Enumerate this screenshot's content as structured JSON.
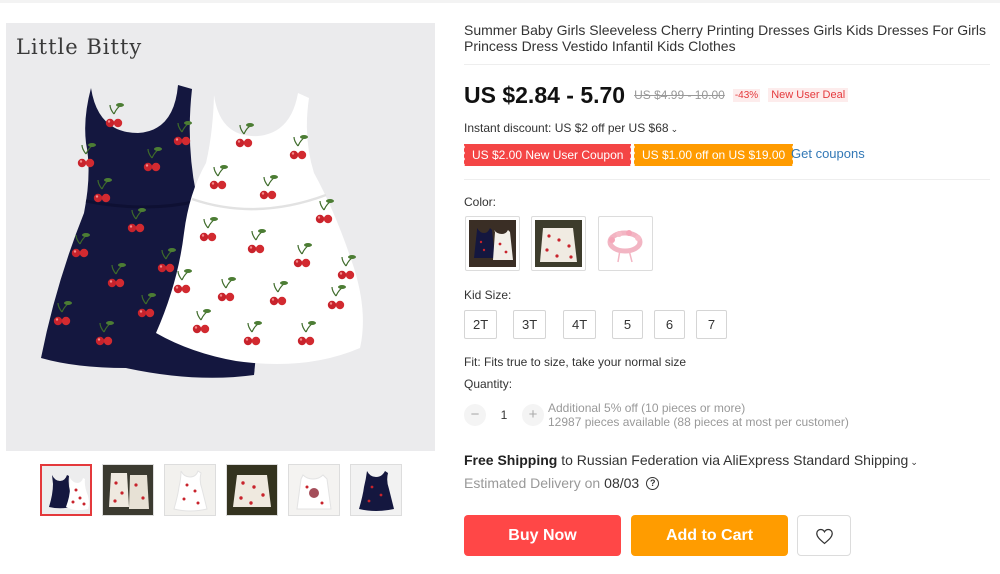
{
  "product": {
    "brand_logo": "Little Bitty",
    "title": "Summer Baby Girls Sleeveless Cherry Printing Dresses Girls Kids Dresses For Girls Princess Dress Vestido Infantil Kids Clothes"
  },
  "pricing": {
    "price": "US $2.84 - 5.70",
    "original_price": "US $4.99 - 10.00",
    "discount": "-43%",
    "deal_badge": "New User Deal",
    "instant_discount": "Instant discount: US $2 off per US $68"
  },
  "coupons": {
    "new_user": "US $2.00 New User Coupon",
    "store": "US $1.00 off on US $19.00",
    "get_link": "Get coupons"
  },
  "color": {
    "label": "Color:",
    "options": [
      "navy-and-white-dresses",
      "white-cherry-dress-set",
      "floral-headband"
    ],
    "selected_index": 0
  },
  "size": {
    "label": "Kid Size:",
    "options": [
      "2T",
      "3T",
      "4T",
      "5",
      "6",
      "7"
    ]
  },
  "fit": "Fit: Fits true to size, take your normal size",
  "quantity": {
    "label": "Quantity:",
    "minus": "−",
    "value": "1",
    "plus": "+",
    "note_line1": "Additional 5% off (10 pieces or more)",
    "note_line2": "12987 pieces available (88 pieces at most per customer)"
  },
  "shipping": {
    "free": "Free Shipping",
    "details": "to Russian Federation via AliExpress Standard Shipping",
    "eta_label": "Estimated Delivery on",
    "eta_date": "08/03",
    "help": "?"
  },
  "actions": {
    "buy_now": "Buy Now",
    "add_to_cart": "Add to Cart"
  },
  "colors": {
    "navy": "#14173f",
    "cherry": "#c8232c",
    "buy": "#ff4747",
    "cart": "#ff9c00",
    "link": "#3278b6"
  }
}
